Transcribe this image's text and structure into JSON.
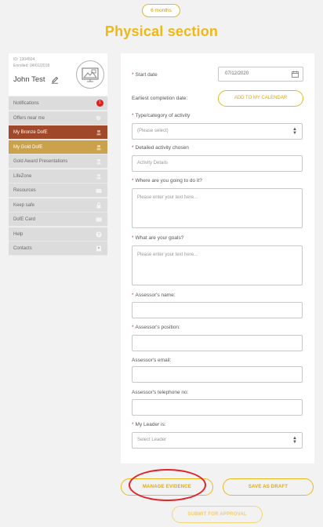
{
  "duration_pill": "6 months",
  "title": "Physical section",
  "profile": {
    "id": "ID: 1304504",
    "enrolled": "Enrolled: 04/01/2018",
    "name": "John Test"
  },
  "sidebar": {
    "items": [
      {
        "label": "Notifications",
        "icon": "bell-icon",
        "badge": "1"
      },
      {
        "label": "Offers near me",
        "icon": "tag-icon"
      },
      {
        "label": "My Bronze DofE",
        "icon": "award-icon",
        "color": "#a0492a"
      },
      {
        "label": "My Gold DofE",
        "icon": "award-icon",
        "color": "#c9a24b"
      },
      {
        "label": "Gold Award Presentations",
        "icon": "award-icon"
      },
      {
        "label": "LifeZone",
        "icon": "award-icon"
      },
      {
        "label": "Resources",
        "icon": "folder-icon"
      },
      {
        "label": "Keep safe",
        "icon": "lock-icon"
      },
      {
        "label": "DofE Card",
        "icon": "card-icon"
      },
      {
        "label": "Help",
        "icon": "help-icon"
      },
      {
        "label": "Contacts",
        "icon": "contact-icon"
      }
    ]
  },
  "form": {
    "start_date_label": "Start date",
    "start_date_value": "07/12/2020",
    "earliest_label": "Earliest completion date:",
    "calendar_button": "ADD TO MY CALENDAR",
    "type_label": "Type/category of activity",
    "type_value": "(Please select)",
    "detail_label": "Detailed activity chosen",
    "detail_placeholder": "Activity Details",
    "where_label": "Where are you going to do it?",
    "where_placeholder": "Please enter your text here...",
    "goals_label": "What are your goals?",
    "goals_placeholder": "Please enter your text here...",
    "assessor_name_label": "Assessor's name:",
    "assessor_position_label": "Assessor's position:",
    "assessor_email_label": "Assessor's email:",
    "assessor_phone_label": "Assessor's telephone no:",
    "leader_label": "My Leader is:",
    "leader_value": "Select Leader"
  },
  "buttons": {
    "manage_evidence": "MANAGE EVIDENCE",
    "save_draft": "SAVE AS DRAFT",
    "submit": "SUBMIT FOR APPROVAL"
  },
  "colors": {
    "accent": "#efb813",
    "bronze": "#a0492a",
    "gold": "#c9a24b",
    "annotation": "#e0222a"
  }
}
